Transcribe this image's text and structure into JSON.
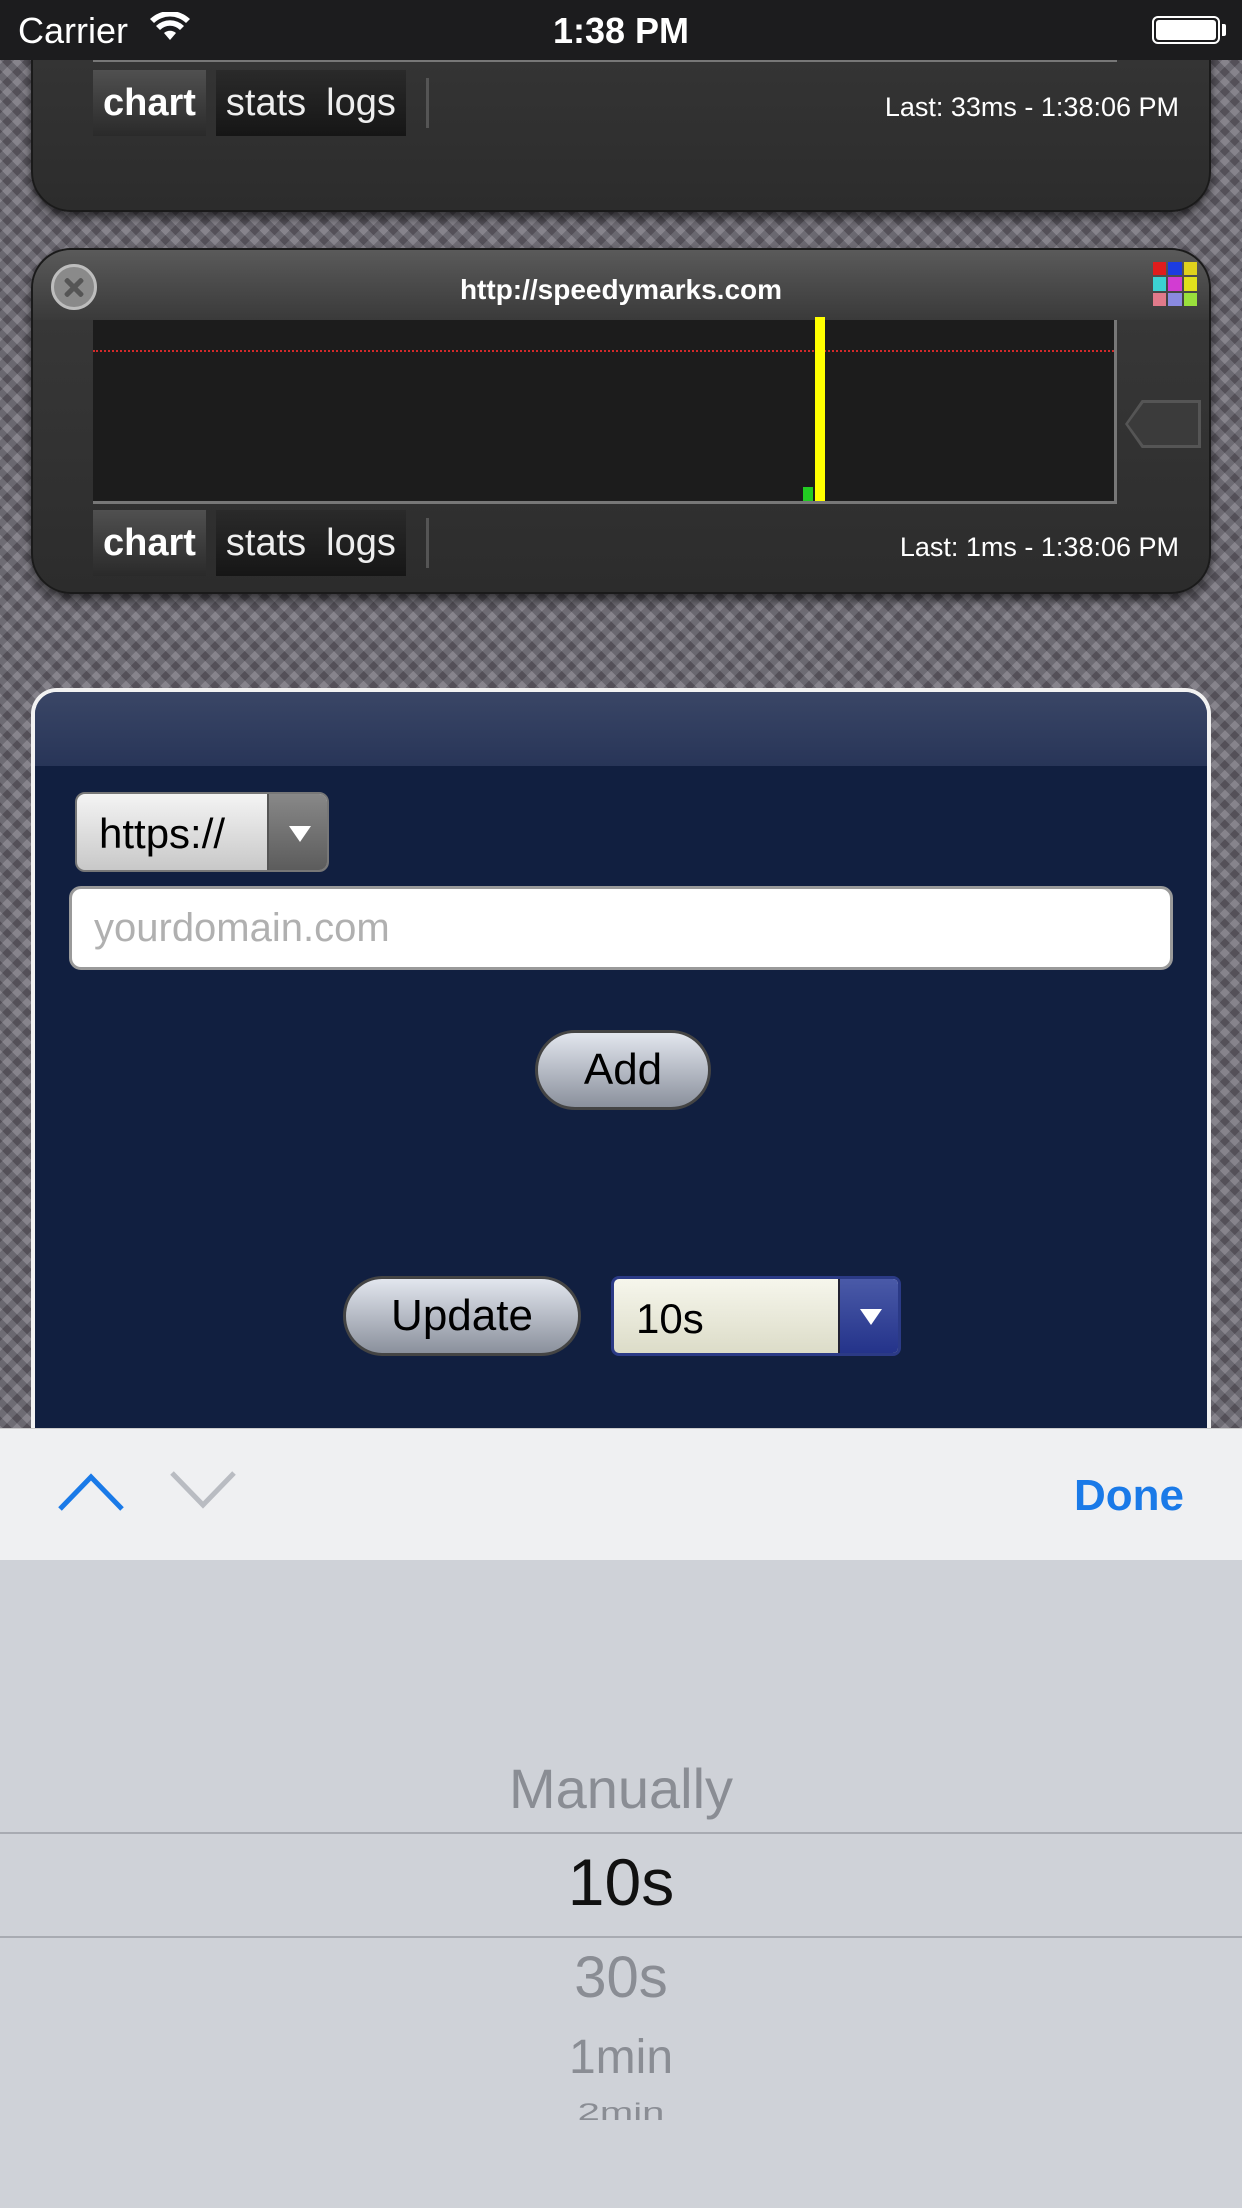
{
  "status_bar": {
    "carrier": "Carrier",
    "time": "1:38 PM"
  },
  "monitors": [
    {
      "url": "",
      "tabs": [
        "chart",
        "stats",
        "logs"
      ],
      "active_tab": "chart",
      "last": "Last: 33ms - 1:38:06 PM",
      "bar_colors": [
        "#22cc22",
        "#ffff00"
      ]
    },
    {
      "url": "http://speedymarks.com",
      "tabs": [
        "chart",
        "stats",
        "logs"
      ],
      "active_tab": "chart",
      "last": "Last: 1ms - 1:38:06 PM",
      "bar_colors": [
        "#22cc22",
        "#ffff00"
      ],
      "threshold_color": "#d12a2a"
    }
  ],
  "add_form": {
    "protocol": "https://",
    "domain_placeholder": "yourdomain.com",
    "domain_value": "",
    "add_label": "Add",
    "update_label": "Update",
    "interval": "10s"
  },
  "toolbar": {
    "done_label": "Done"
  },
  "picker": {
    "items": [
      "Manually",
      "10s",
      "30s",
      "1min",
      "2min"
    ],
    "selected": "10s"
  },
  "colors": {
    "accent": "#1a7ae8",
    "panel_bg": "#111f40",
    "select_border": "#2b3a86"
  }
}
